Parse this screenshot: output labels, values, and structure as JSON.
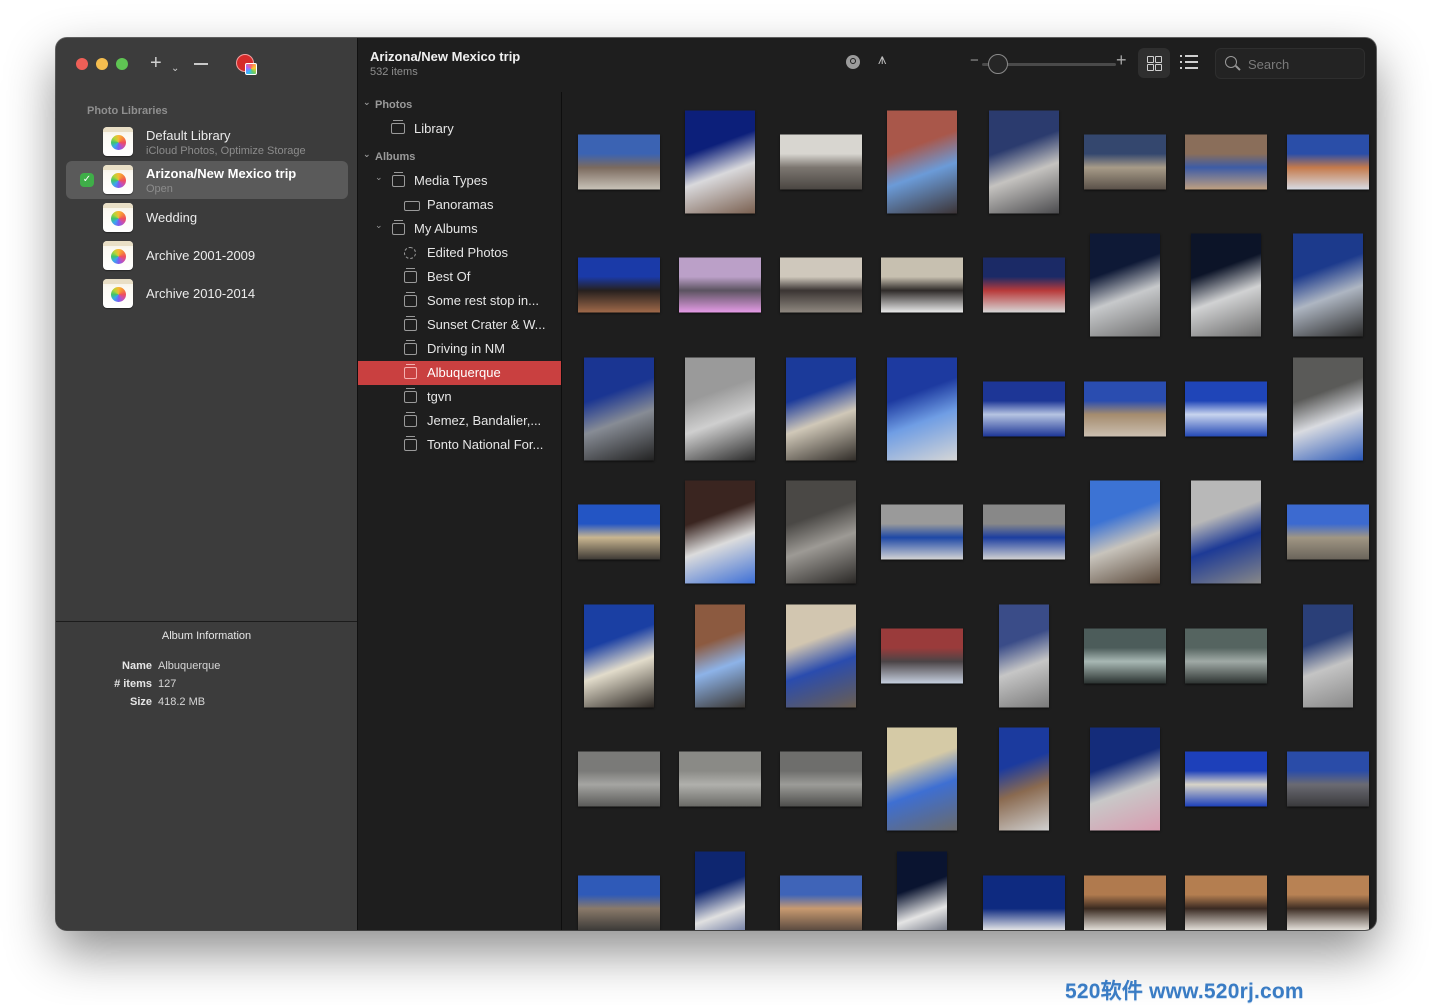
{
  "window": {
    "controls": [
      "close",
      "minimize",
      "maximize"
    ]
  },
  "sidebar": {
    "toolbar": {
      "add_icon": "plus-icon",
      "add_menu_icon": "chevron-down-icon",
      "remove_icon": "minus-icon",
      "app_icon": "photos-app-badge-icon"
    },
    "section_title": "Photo Libraries",
    "libraries": [
      {
        "name": "Default Library",
        "subtitle": "iCloud Photos, Optimize Storage",
        "selected": false,
        "open": false
      },
      {
        "name": "Arizona/New Mexico trip",
        "subtitle": "Open",
        "selected": true,
        "open": true
      },
      {
        "name": "Wedding",
        "subtitle": "",
        "selected": false,
        "open": false
      },
      {
        "name": "Archive 2001-2009",
        "subtitle": "",
        "selected": false,
        "open": false
      },
      {
        "name": "Archive 2010-2014",
        "subtitle": "",
        "selected": false,
        "open": false
      }
    ],
    "album_info": {
      "title": "Album Information",
      "rows": [
        {
          "key": "Name",
          "value": "Albuquerque"
        },
        {
          "key": "# items",
          "value": "127"
        },
        {
          "key": "Size",
          "value": "418.2 MB"
        }
      ]
    }
  },
  "header": {
    "title": "Arizona/New Mexico trip",
    "subtitle": "532 items",
    "toolbar": {
      "zoom_minus": "−",
      "zoom_plus": "+",
      "zoom_level": 0.05,
      "view_mode": "grid",
      "search_placeholder": "Search",
      "search_value": ""
    }
  },
  "tree": [
    {
      "label": "Photos",
      "type": "section",
      "level": 0,
      "expanded": true
    },
    {
      "label": "Library",
      "type": "library",
      "level": 1
    },
    {
      "label": "Albums",
      "type": "section",
      "level": 0,
      "expanded": true
    },
    {
      "label": "Media Types",
      "type": "folder",
      "level": 1,
      "expanded": true
    },
    {
      "label": "Panoramas",
      "type": "panorama",
      "level": 2
    },
    {
      "label": "My Albums",
      "type": "folder",
      "level": 1,
      "expanded": true
    },
    {
      "label": "Edited Photos",
      "type": "smart",
      "level": 2
    },
    {
      "label": "Best Of",
      "type": "album",
      "level": 2
    },
    {
      "label": "Some rest stop in...",
      "type": "album",
      "level": 2
    },
    {
      "label": "Sunset Crater & W...",
      "type": "album",
      "level": 2
    },
    {
      "label": "Driving in NM",
      "type": "album",
      "level": 2
    },
    {
      "label": "Albuquerque",
      "type": "album",
      "level": 2,
      "selected": true
    },
    {
      "label": "tgvn",
      "type": "album",
      "level": 2
    },
    {
      "label": "Jemez, Bandalier,...",
      "type": "album",
      "level": 2
    },
    {
      "label": "Tonto National For...",
      "type": "album",
      "level": 2
    }
  ],
  "photos": [
    {
      "shape": "land",
      "desc": "street with blue sky and brick building",
      "colors": [
        "#3b63b3",
        "#7b6a5e",
        "#c9c3b8"
      ]
    },
    {
      "shape": "port",
      "desc": "white building and street under deep blue sky",
      "colors": [
        "#0c1f7a",
        "#d9d9dc",
        "#7a6050"
      ]
    },
    {
      "shape": "land",
      "desc": "arcade with arches",
      "colors": [
        "#d8d6d0",
        "#7c7670",
        "#4a4642"
      ]
    },
    {
      "shape": "port",
      "desc": "narrow alley with red walls",
      "colors": [
        "#a9574a",
        "#6b9bd8",
        "#3c3436"
      ]
    },
    {
      "shape": "port",
      "desc": "colonnade arches",
      "colors": [
        "#2b3b6e",
        "#c5c3c0",
        "#4b4b4e"
      ]
    },
    {
      "shape": "land",
      "desc": "BURT'S painted wall",
      "colors": [
        "#34476e",
        "#a79b88",
        "#5a5149"
      ]
    },
    {
      "shape": "land",
      "desc": "mosaic tiles",
      "colors": [
        "#8a6e5a",
        "#3d5ca6",
        "#c0a080"
      ]
    },
    {
      "shape": "land",
      "desc": "building reflection in glass",
      "colors": [
        "#2a4ea8",
        "#c57a4b",
        "#d7dbe4"
      ]
    },
    {
      "shape": "land",
      "desc": "tower against blue sky",
      "colors": [
        "#1a3aa8",
        "#26201e",
        "#a06a4a"
      ]
    },
    {
      "shape": "land",
      "desc": "pink neon sign",
      "colors": [
        "#bba0c8",
        "#5b5360",
        "#e59ce6"
      ]
    },
    {
      "shape": "land",
      "desc": "storefront building",
      "colors": [
        "#cfc8bc",
        "#3b3533",
        "#8f8880"
      ]
    },
    {
      "shape": "land",
      "desc": "building facade with snow",
      "colors": [
        "#c7c0b0",
        "#2f2b29",
        "#eaeaea"
      ]
    },
    {
      "shape": "land",
      "desc": "colorful facade reflection",
      "colors": [
        "#1b2a66",
        "#b83a3a",
        "#d7d7d7"
      ]
    },
    {
      "shape": "port",
      "desc": "white building under dark sky",
      "colors": [
        "#0e1936",
        "#c7c9cb",
        "#6d6d6d"
      ]
    },
    {
      "shape": "port",
      "desc": "white corner building",
      "colors": [
        "#0c1428",
        "#d1d2d3",
        "#6a6a6a"
      ]
    },
    {
      "shape": "port",
      "desc": "glass building and cars",
      "colors": [
        "#1c3a8c",
        "#aeb6c2",
        "#2a2a2a"
      ]
    },
    {
      "shape": "port",
      "desc": "glass tower reflection",
      "colors": [
        "#1a3592",
        "#878c95",
        "#222"
      ]
    },
    {
      "shape": "port",
      "desc": "concrete facade with windows",
      "colors": [
        "#9a9a9a",
        "#cfcfcf",
        "#2a2a2a"
      ]
    },
    {
      "shape": "port",
      "desc": "shadows under blue beams",
      "colors": [
        "#1b3a9a",
        "#d0c8b8",
        "#302c28"
      ]
    },
    {
      "shape": "port",
      "desc": "blue beams and balconies",
      "colors": [
        "#1d3aa0",
        "#6f9de4",
        "#d6d6d6"
      ]
    },
    {
      "shape": "land",
      "desc": "white truss structure",
      "colors": [
        "#1d3696",
        "#b6c4e2",
        "#1d3696"
      ]
    },
    {
      "shape": "land",
      "desc": "plaza with canopy",
      "colors": [
        "#2a4db0",
        "#a58c6e",
        "#cbbfb0"
      ]
    },
    {
      "shape": "land",
      "desc": "truss against sky",
      "colors": [
        "#1f45b8",
        "#c8d4ee",
        "#2449b6"
      ]
    },
    {
      "shape": "port",
      "desc": "office building with blue awning",
      "colors": [
        "#5a5a58",
        "#d9dbe0",
        "#2a58b8"
      ]
    },
    {
      "shape": "land",
      "desc": "street with mountains",
      "colors": [
        "#2355c4",
        "#c9b690",
        "#3e3a36"
      ]
    },
    {
      "shape": "port",
      "desc": "brown building balconies",
      "colors": [
        "#3a2520",
        "#dcdcdc",
        "#3d6fd6"
      ]
    },
    {
      "shape": "port",
      "desc": "metal wall panels",
      "colors": [
        "#4a4845",
        "#9d9a95",
        "#2a2826"
      ]
    },
    {
      "shape": "land",
      "desc": "looking up between buildings",
      "colors": [
        "#9a9a9a",
        "#1e48a6",
        "#d4d4d4"
      ]
    },
    {
      "shape": "land",
      "desc": "looking up between buildings 2",
      "colors": [
        "#888888",
        "#1c3ea0",
        "#d2d2d2"
      ]
    },
    {
      "shape": "port",
      "desc": "street of buildings",
      "colors": [
        "#3c73d4",
        "#c8c4bc",
        "#5b4a3c"
      ]
    },
    {
      "shape": "port",
      "desc": "arched window reflection",
      "colors": [
        "#b8b8b8",
        "#1d3a96",
        "#888"
      ]
    },
    {
      "shape": "land",
      "desc": "building with statue",
      "colors": [
        "#3c6ad0",
        "#a09684",
        "#6a645a"
      ]
    },
    {
      "shape": "port",
      "desc": "white building under blue sky",
      "colors": [
        "#1a3fa3",
        "#e2dccb",
        "#2b2622"
      ]
    },
    {
      "shape": "narrow",
      "desc": "alley with power lines",
      "colors": [
        "#8c5a40",
        "#8db3e8",
        "#3a3632"
      ]
    },
    {
      "shape": "port",
      "desc": "decorative building facade",
      "colors": [
        "#d2c6b0",
        "#2a4cae",
        "#6a5e50"
      ]
    },
    {
      "shape": "land",
      "desc": "colorful street corner",
      "colors": [
        "#9a3b3b",
        "#4b4446",
        "#c6d0e0"
      ]
    },
    {
      "shape": "narrow",
      "desc": "reflection on window",
      "colors": [
        "#3a4c88",
        "#c6c6c6",
        "#7a7a7a"
      ]
    },
    {
      "shape": "land",
      "desc": "silhouette at window",
      "colors": [
        "#4c5c5a",
        "#a8b8b4",
        "#2a3230"
      ]
    },
    {
      "shape": "land",
      "desc": "silhouette at window 2",
      "colors": [
        "#556460",
        "#a0aaa6",
        "#2e3432"
      ]
    },
    {
      "shape": "narrow",
      "desc": "reflection on wall",
      "colors": [
        "#2a3f78",
        "#c4c4c4",
        "#888"
      ]
    },
    {
      "shape": "land",
      "desc": "grey wall reflections",
      "colors": [
        "#7a7a78",
        "#a5a5a2",
        "#5a5a58"
      ]
    },
    {
      "shape": "land",
      "desc": "grey wall reflections 2",
      "colors": [
        "#8a8a86",
        "#b0b0ac",
        "#6a6a66"
      ]
    },
    {
      "shape": "land",
      "desc": "grey wall reflections 3",
      "colors": [
        "#6e6e6c",
        "#9c9c98",
        "#4e4e4c"
      ]
    },
    {
      "shape": "port",
      "desc": "yellow building reflection",
      "colors": [
        "#d5caa6",
        "#3e6fd2",
        "#6a6a6a"
      ]
    },
    {
      "shape": "narrow",
      "desc": "round tower downtown",
      "colors": [
        "#1b3a9e",
        "#8a6a50",
        "#d0d0d0"
      ]
    },
    {
      "shape": "port",
      "desc": "buildings and pink trailer",
      "colors": [
        "#142c7a",
        "#c8c8c8",
        "#d89cb0"
      ]
    },
    {
      "shape": "land",
      "desc": "flag on building",
      "colors": [
        "#1d40ba",
        "#d8d4c8",
        "#1d40ba"
      ]
    },
    {
      "shape": "land",
      "desc": "parking lot with buildings",
      "colors": [
        "#2a4ca8",
        "#6a6a72",
        "#3a3a3c"
      ]
    },
    {
      "shape": "land",
      "desc": "parking lot",
      "colors": [
        "#2f5ab8",
        "#8a7a6a",
        "#3c3a38"
      ]
    },
    {
      "shape": "narrow",
      "desc": "white tall building",
      "colors": [
        "#0e2670",
        "#e0e0e0",
        "#0e2670"
      ]
    },
    {
      "shape": "land",
      "desc": "mural",
      "colors": [
        "#3f64b8",
        "#c89a70",
        "#5a4a40"
      ]
    },
    {
      "shape": "narrow",
      "desc": "white tall building 2",
      "colors": [
        "#0a1430",
        "#e4e4e4",
        "#0a1430"
      ]
    },
    {
      "shape": "land",
      "desc": "building top under dark sky",
      "colors": [
        "#0e2a80",
        "#0e2a80",
        "#e8e8e8"
      ]
    },
    {
      "shape": "land",
      "desc": "person with sign under tree",
      "colors": [
        "#b07a4e",
        "#3a2a20",
        "#e6e2dc"
      ]
    },
    {
      "shape": "land",
      "desc": "person with sign under tree 2",
      "colors": [
        "#b47e50",
        "#3a2a22",
        "#e6e2dc"
      ]
    },
    {
      "shape": "land",
      "desc": "sign under tree",
      "colors": [
        "#b88254",
        "#3e2e24",
        "#e8e4de"
      ]
    }
  ],
  "watermark": "520软件 www.520rj.com"
}
